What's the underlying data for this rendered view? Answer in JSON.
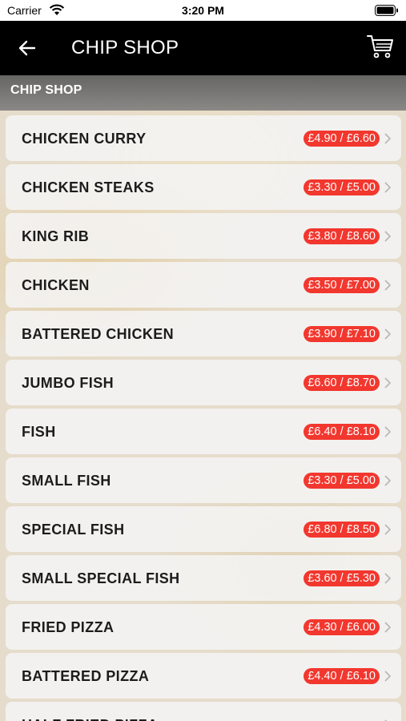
{
  "status_bar": {
    "carrier": "Carrier",
    "time": "3:20 PM"
  },
  "nav": {
    "title": "CHIP SHOP",
    "back_icon": "arrow-left-icon",
    "cart_icon": "cart-icon"
  },
  "section": {
    "title": "CHIP SHOP"
  },
  "colors": {
    "nav_bg": "#000000",
    "price_badge": "#f2372e",
    "row_bg": "#f4f4f4"
  },
  "menu_items": [
    {
      "name": "CHICKEN CURRY",
      "price": "£4.90 / £6.60"
    },
    {
      "name": "CHICKEN STEAKS",
      "price": "£3.30 / £5.00"
    },
    {
      "name": "KING RIB",
      "price": "£3.80 / £8.60"
    },
    {
      "name": "CHICKEN",
      "price": "£3.50 / £7.00"
    },
    {
      "name": "BATTERED CHICKEN",
      "price": "£3.90 / £7.10"
    },
    {
      "name": "JUMBO FISH",
      "price": "£6.60 / £8.70"
    },
    {
      "name": "FISH",
      "price": "£6.40 / £8.10"
    },
    {
      "name": "SMALL FISH",
      "price": "£3.30 / £5.00"
    },
    {
      "name": "SPECIAL FISH",
      "price": "£6.80 / £8.50"
    },
    {
      "name": "SMALL SPECIAL FISH",
      "price": "£3.60 / £5.30"
    },
    {
      "name": "FRIED PIZZA",
      "price": "£4.30 / £6.00"
    },
    {
      "name": "BATTERED PIZZA",
      "price": "£4.40 / £6.10"
    },
    {
      "name": "HALF FRIED PIZZA",
      "price": ""
    }
  ]
}
